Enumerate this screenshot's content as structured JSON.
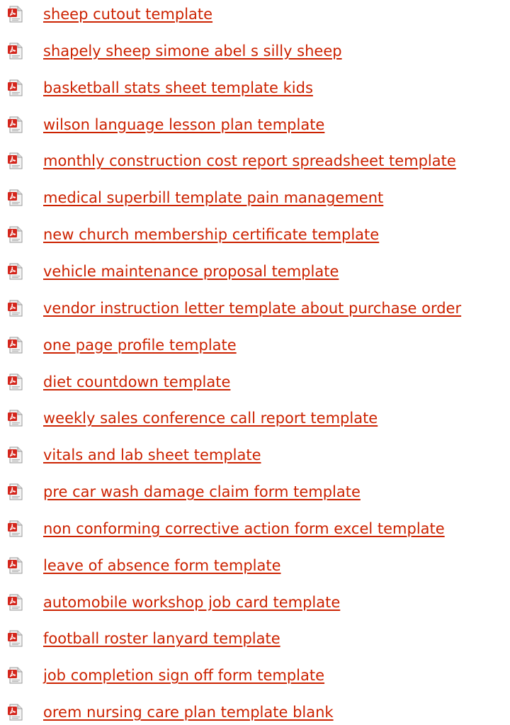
{
  "link_color": "#cc2200",
  "icon": "pdf-document-icon",
  "links": [
    "sheep cutout template",
    "shapely sheep simone abel s silly sheep",
    "basketball stats sheet template kids",
    "wilson language lesson plan template",
    "monthly construction cost report spreadsheet template",
    "medical superbill template pain management",
    "new church membership certificate template",
    "vehicle maintenance proposal template",
    "vendor instruction letter template about purchase order",
    "one page profile template",
    "diet countdown template",
    "weekly sales conference call report template",
    "vitals and lab sheet template",
    "pre car wash damage claim form template",
    "non conforming corrective action form excel template",
    "leave of absence form template",
    "automobile workshop job card template",
    "football roster lanyard template",
    "job completion sign off form template",
    "orem nursing care plan template blank"
  ]
}
